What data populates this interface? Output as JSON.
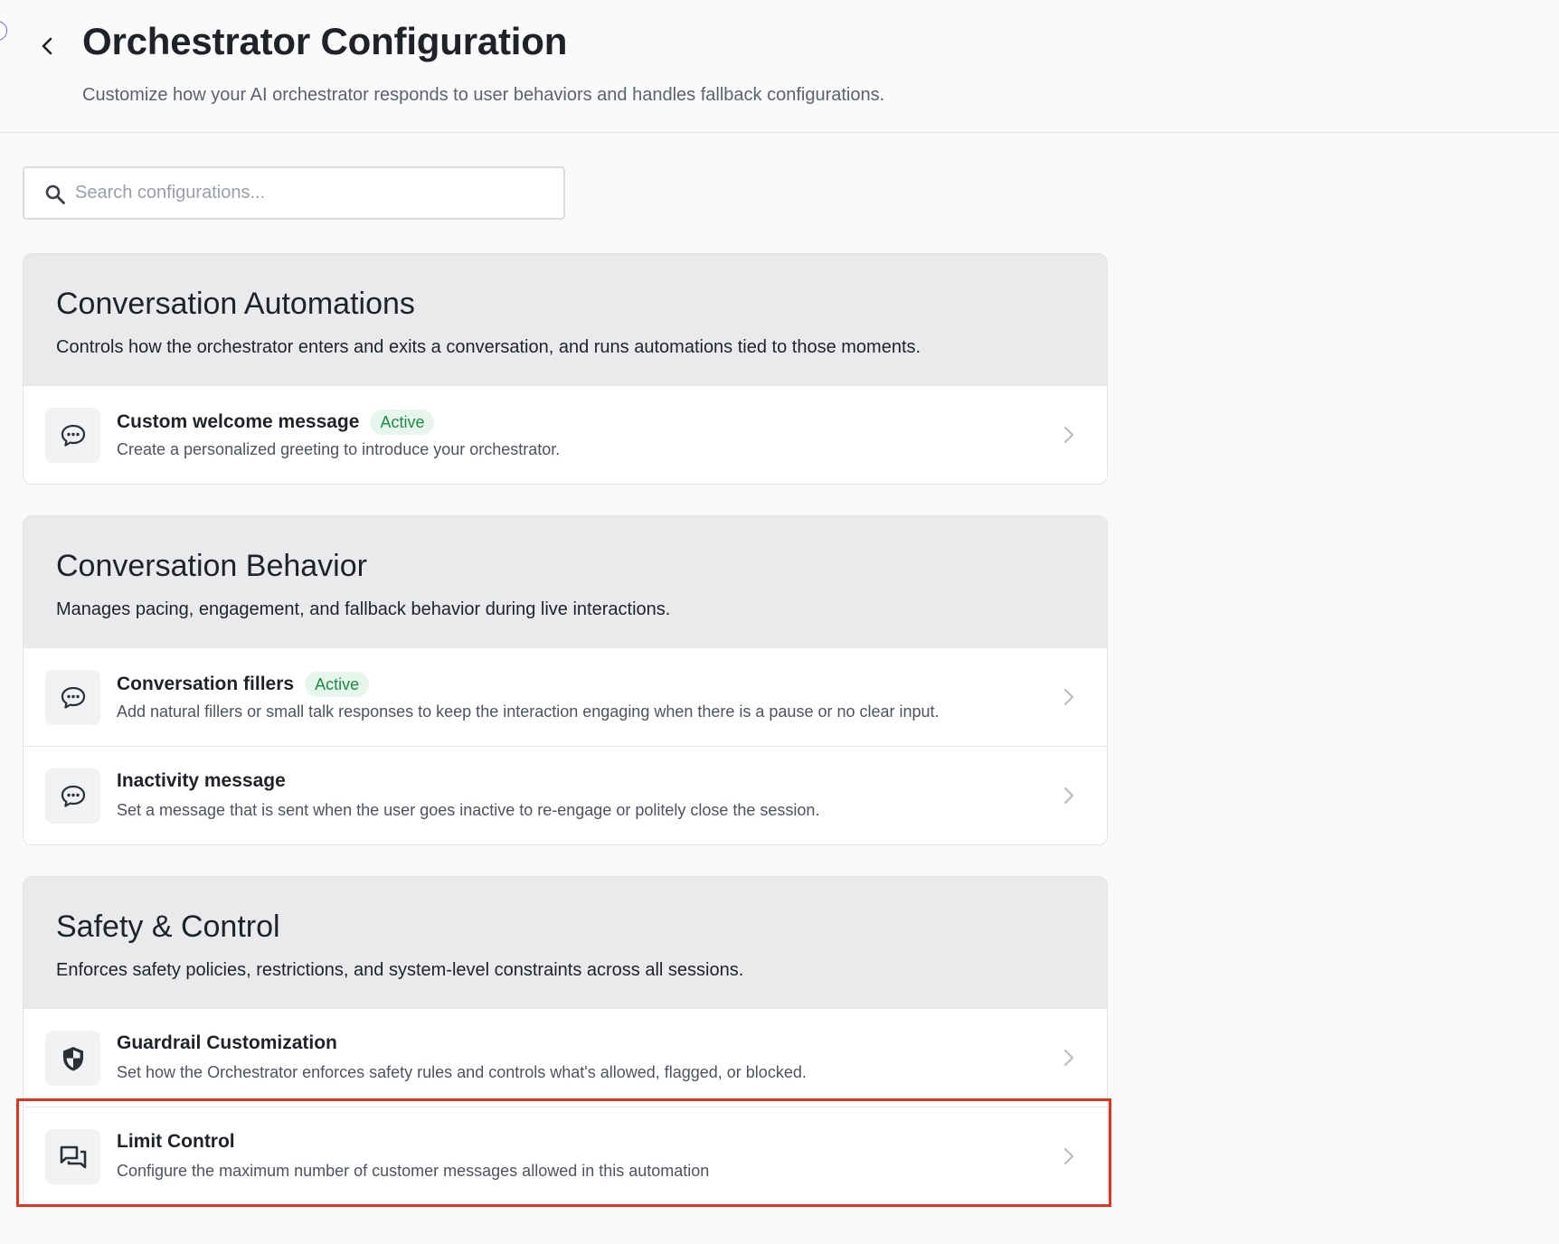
{
  "header": {
    "title": "Orchestrator Configuration",
    "subtitle": "Customize how your AI orchestrator responds to user behaviors and handles fallback configurations.",
    "back_icon": "chevron-left-icon"
  },
  "search": {
    "placeholder": "Search configurations...",
    "value": "",
    "icon": "search-icon"
  },
  "sections": [
    {
      "title": "Conversation Automations",
      "description": "Controls how the orchestrator enters and exits a conversation, and runs automations tied to those moments.",
      "items": [
        {
          "title": "Custom welcome message",
          "badge": "Active",
          "description": "Create a personalized greeting to introduce your orchestrator.",
          "icon": "chat-bubble-icon"
        }
      ]
    },
    {
      "title": "Conversation Behavior",
      "description": "Manages pacing, engagement, and fallback behavior during live interactions.",
      "items": [
        {
          "title": "Conversation fillers",
          "badge": "Active",
          "description": "Add natural fillers or small talk responses to keep the interaction engaging when there is a pause or no clear input.",
          "icon": "chat-bubble-icon"
        },
        {
          "title": "Inactivity message",
          "description": "Set a message that is sent when the user goes inactive to re-engage or politely close the session.",
          "icon": "chat-bubble-icon"
        }
      ]
    },
    {
      "title": "Safety & Control",
      "description": "Enforces safety policies, restrictions, and system-level constraints across all sessions.",
      "items": [
        {
          "title": "Guardrail Customization",
          "description": "Set how the Orchestrator enforces safety rules and controls what's allowed, flagged, or blocked.",
          "icon": "shield-icon"
        },
        {
          "title": "Limit Control",
          "description": "Configure the maximum number of customer messages allowed in this automation",
          "icon": "forum-icon",
          "highlighted": true
        }
      ]
    }
  ],
  "colors": {
    "badge_bg": "#e7f6ec",
    "badge_text": "#1e8a45",
    "highlight": "#e3321f",
    "section_head_bg": "#e9eaec"
  }
}
